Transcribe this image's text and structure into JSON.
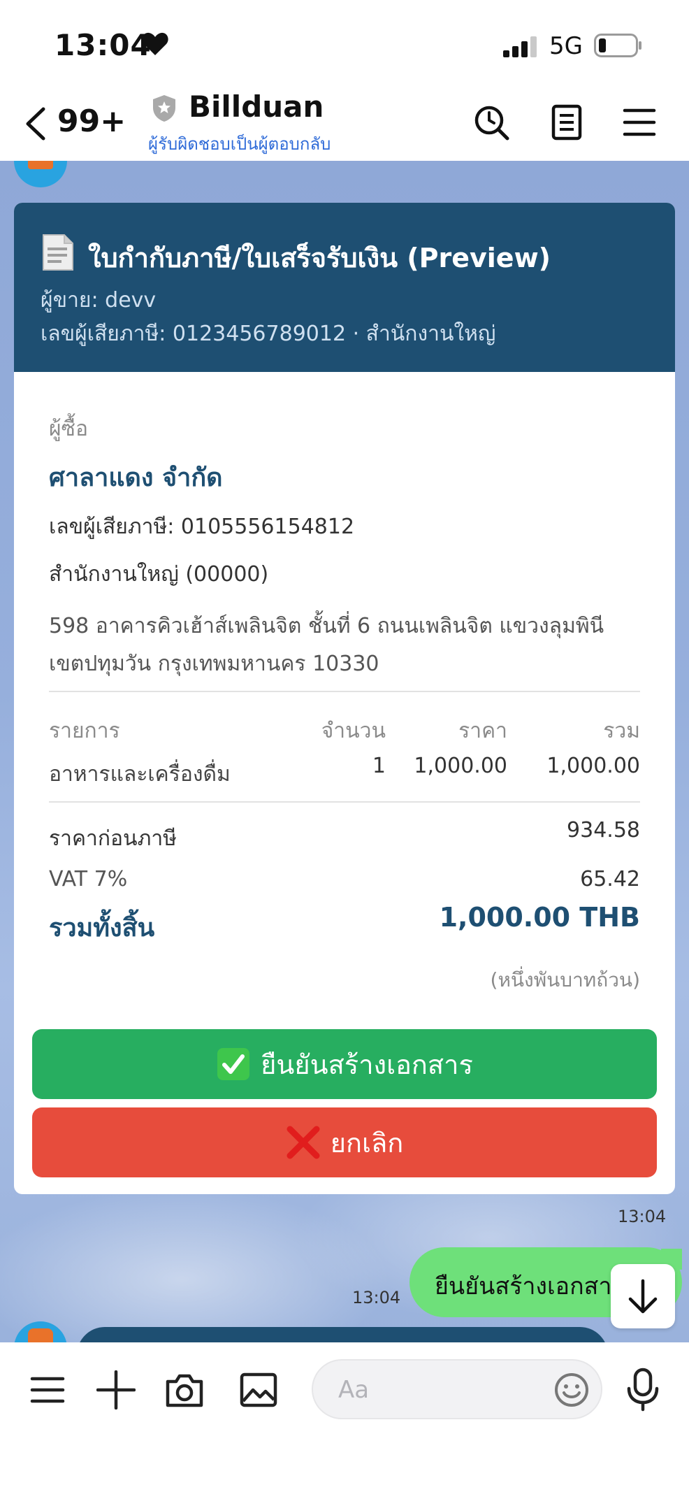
{
  "status_bar": {
    "time": "13:04",
    "network": "5G"
  },
  "header": {
    "back_count": "99+",
    "title": "Billduan",
    "subtitle": "ผู้รับผิดชอบเป็นผู้ตอบกลับ"
  },
  "invoice": {
    "title": "ใบกำกับภาษี/ใบเสร็จรับเงิน (Preview)",
    "seller": "ผู้ขาย: devv",
    "seller_tax": "เลขผู้เสียภาษี: 0123456789012 · สำนักงานใหญ่",
    "buyer_label": "ผู้ซื้อ",
    "buyer_name": "ศาลาแดง จำกัด",
    "buyer_tax": "เลขผู้เสียภาษี: 0105556154812",
    "buyer_branch": "สำนักงานใหญ่ (00000)",
    "buyer_address_line1": "598 อาคารคิวเฮ้าส์เพลินจิต ชั้นที่ 6 ถนนเพลินจิต  แขวงลุมพินี",
    "buyer_address_line2": "เขตปทุมวัน กรุงเทพมหานคร 10330",
    "columns": {
      "item": "รายการ",
      "qty": "จำนวน",
      "price": "ราคา",
      "total": "รวม"
    },
    "items": [
      {
        "name": "อาหารและเครื่องดื่ม",
        "qty": "1",
        "price": "1,000.00",
        "total": "1,000.00"
      }
    ],
    "subtotal_label": "ราคาก่อนภาษี",
    "subtotal": "934.58",
    "vat_label": "VAT 7%",
    "vat": "65.42",
    "grand_total_label": "รวมทั้งสิ้น",
    "grand_total": "1,000.00 THB",
    "amount_words": "(หนึ่งพันบาทถ้วน)",
    "confirm_label": "ยืนยันสร้างเอกสาร",
    "cancel_label": "ยกเลิก",
    "timestamp": "13:04"
  },
  "my_message": {
    "text": "ยืนยันสร้างเอกสาร",
    "timestamp": "13:04"
  },
  "input": {
    "placeholder": "Aa"
  },
  "colors": {
    "header_blue": "#1e4f72",
    "confirm_green": "#27ae60",
    "cancel_red": "#e74c3c",
    "my_bubble": "#6ee07a",
    "chat_bg": "#8fa8d7"
  }
}
